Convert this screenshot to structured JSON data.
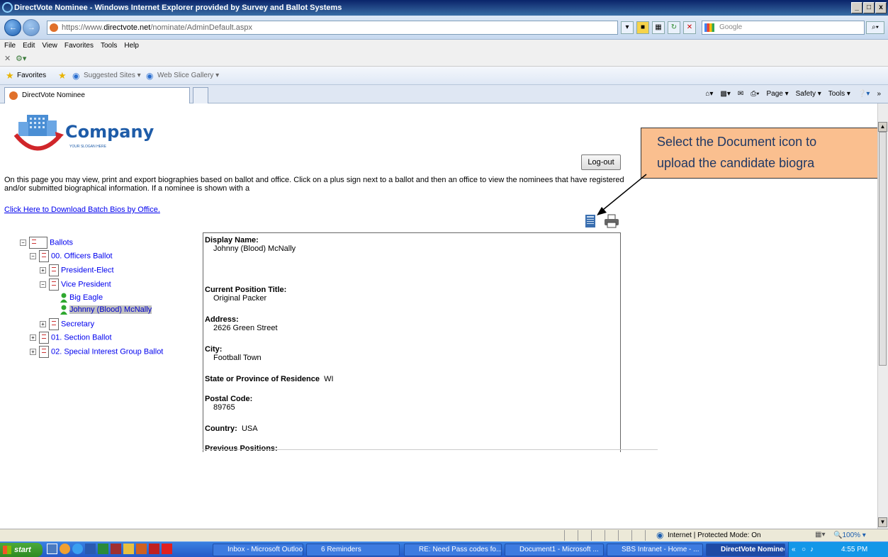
{
  "window": {
    "title": "DirectVote Nominee - Windows Internet Explorer provided by Survey and Ballot Systems",
    "min": "_",
    "max": "̲̲",
    "close": "x"
  },
  "addressbar": {
    "url_prefix": "https://www.",
    "url_domain": "directvote.net",
    "url_path": "/nominate/AdminDefault.aspx",
    "search_placeholder": "Google"
  },
  "menu": {
    "items": [
      "File",
      "Edit",
      "View",
      "Favorites",
      "Tools",
      "Help"
    ]
  },
  "favorites": {
    "label": "Favorites",
    "suggested": "Suggested Sites ▾",
    "webslice": "Web Slice Gallery ▾"
  },
  "tab": {
    "label": "DirectVote Nominee"
  },
  "commandbar": {
    "items": [
      "Page ▾",
      "Safety ▾",
      "Tools ▾"
    ]
  },
  "page": {
    "logo_text": "Company",
    "logo_slogan": "YOUR SLOGAN HERE",
    "logout_label": "Log-out",
    "intro": "On this page you may view, print and export biographies based on ballot and office. Click on a plus sign next to a ballot and then an office to view the nominees that have registered and/or submitted biographical information. If a nominee is shown with a",
    "download_link": "Click Here to Download Batch Bios by Office.",
    "tree": {
      "root": "Ballots",
      "ballot0": "00. Officers Ballot",
      "office1": "President-Elect",
      "office2": "Vice President",
      "nominee1": "Big Eagle",
      "nominee2": "Johnny (Blood) McNally",
      "office3": "Secretary",
      "ballot1": "01. Section Ballot",
      "ballot2": "02. Special Interest Group Ballot"
    },
    "detail": {
      "display_name_label": "Display Name:",
      "display_name": "Johnny (Blood) McNally",
      "position_label": "Current Position Title:",
      "position": "Original Packer",
      "address_label": "Address:",
      "address": "2626 Green Street",
      "city_label": "City:",
      "city": "Football Town",
      "state_label": "State or Province of Residence",
      "state": "WI",
      "postal_label": "Postal Code:",
      "postal": "89765",
      "country_label": "Country:",
      "country": "USA",
      "prev_label": "Previous Positions:"
    },
    "callout": {
      "line1": "Select the Document icon to",
      "line2": "upload the candidate biogra"
    }
  },
  "statusbar": {
    "zone": "Internet | Protected Mode: On",
    "zoom": "🔍100% ▾"
  },
  "taskbar": {
    "start": "start",
    "buttons": [
      "Inbox - Microsoft Outlook",
      "6 Reminders",
      "RE: Need Pass codes fo...",
      "Document1 - Microsoft ...",
      "SBS Intranet - Home - ...",
      "DirectVote Nominee -..."
    ],
    "clock": "4:55 PM"
  },
  "colors": {
    "callout_bg": "#fabf8f",
    "link": "#0000ee",
    "logo_blue": "#1e5ca8",
    "logo_red": "#d0262a"
  }
}
